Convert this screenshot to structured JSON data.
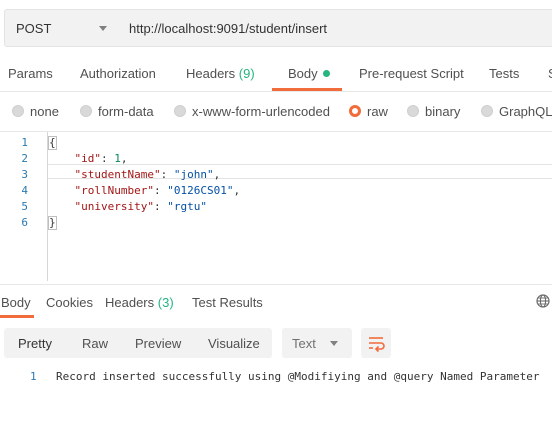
{
  "request": {
    "method": "POST",
    "url": "http://localhost:9091/student/insert"
  },
  "request_tabs": [
    {
      "label": "Params"
    },
    {
      "label": "Authorization"
    },
    {
      "label": "Headers",
      "count": "(9)"
    },
    {
      "label": "Body",
      "active": true
    },
    {
      "label": "Pre-request Script"
    },
    {
      "label": "Tests"
    },
    {
      "label": "S"
    }
  ],
  "body_types": [
    {
      "label": "none",
      "checked": false
    },
    {
      "label": "form-data",
      "checked": false
    },
    {
      "label": "x-www-form-urlencoded",
      "checked": false
    },
    {
      "label": "raw",
      "checked": true
    },
    {
      "label": "binary",
      "checked": false
    },
    {
      "label": "GraphQL",
      "checked": false
    }
  ],
  "editor": {
    "line_numbers": [
      "1",
      "2",
      "3",
      "4",
      "5",
      "6"
    ],
    "lines": [
      {
        "open_brace": "{"
      },
      {
        "key": "\"id\"",
        "value": "1",
        "value_type": "number"
      },
      {
        "key": "\"studentName\"",
        "value": "\"john\"",
        "value_type": "string"
      },
      {
        "key": "\"rollNumber\"",
        "value": "\"0126CS01\"",
        "value_type": "string"
      },
      {
        "key": "\"university\"",
        "value": "\"rgtu\"",
        "value_type": "string"
      },
      {
        "close_brace": "}"
      }
    ]
  },
  "response_tabs": [
    {
      "label": "Body",
      "active": true
    },
    {
      "label": "Cookies"
    },
    {
      "label": "Headers",
      "count": "(3)"
    },
    {
      "label": "Test Results"
    }
  ],
  "response_view": {
    "modes": [
      "Pretty",
      "Raw",
      "Preview",
      "Visualize"
    ],
    "active_mode": "Pretty",
    "format": "Text"
  },
  "response_body": {
    "line_number": "1",
    "text": "Record inserted successfully using @Modifiying and @query Named Parameter"
  },
  "colors": {
    "accent": "#f26b3a",
    "count_green": "#26b47f",
    "json_key": "#a31515",
    "json_string": "#0451a5",
    "json_number": "#098658",
    "line_number": "#2a7ab0"
  }
}
